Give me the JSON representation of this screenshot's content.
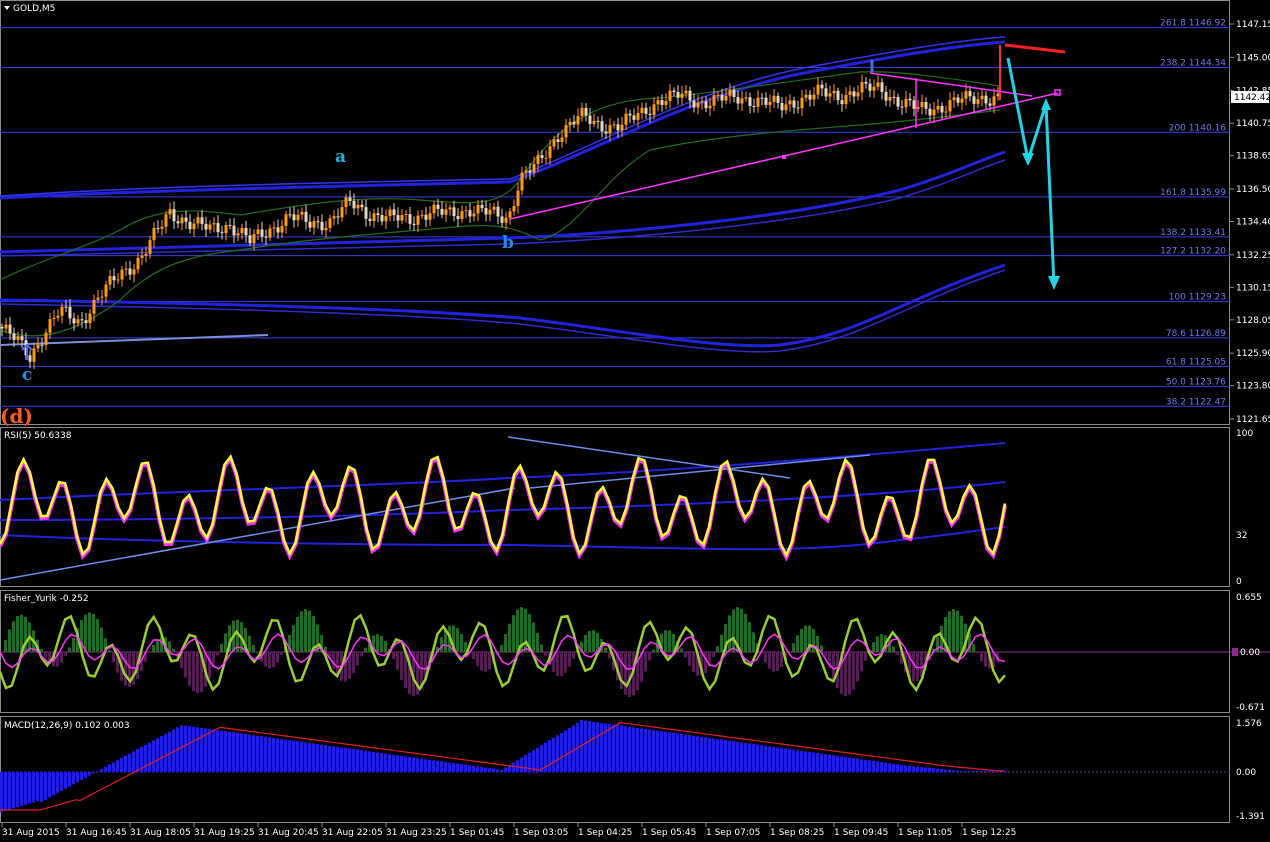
{
  "symbol_title": "GOLD,M5",
  "colors": {
    "background": "#000000",
    "fib_line": "#3a3fd8",
    "rsi_line": "#ffff33",
    "fisher_line": "#9acd32",
    "macd_hist": "#1f1fe0",
    "signal": "#e0205a",
    "trendline": "#ff33ff",
    "projection": "#22d3e6",
    "red_line": "#ff2020"
  },
  "main_axis": {
    "ticks": [
      "1147.15",
      "1145.00",
      "1142.85",
      "1140.75",
      "1138.65",
      "1136.50",
      "1134.40",
      "1132.25",
      "1130.15",
      "1128.05",
      "1125.90",
      "1123.80",
      "1121.65"
    ],
    "current_price": "1142.42"
  },
  "fib_levels": [
    {
      "label": "261.8 1146.92",
      "price": 1146.92
    },
    {
      "label": "238.2 1144.34",
      "price": 1144.34
    },
    {
      "label": "200 1140.16",
      "price": 1140.16
    },
    {
      "label": "161.8 1135.99",
      "price": 1135.99
    },
    {
      "label": "138.2 1133.41",
      "price": 1133.41
    },
    {
      "label": "127.2 1132.20",
      "price": 1132.2
    },
    {
      "label": "100 1129.23",
      "price": 1129.23
    },
    {
      "label": "78.6 1126.89",
      "price": 1126.89
    },
    {
      "label": "61.8 1125.05",
      "price": 1125.05
    },
    {
      "label": "50.0 1123.76",
      "price": 1123.76
    },
    {
      "label": "38.2 1122.47",
      "price": 1122.47
    }
  ],
  "wave_labels": {
    "a": "a",
    "b": "b",
    "c": "c",
    "d": "(d)"
  },
  "rsi": {
    "title": "RSI(5) 50.6338",
    "ticks": [
      "100",
      "32",
      "0"
    ]
  },
  "fisher": {
    "title": "Fisher_Yurik -0.252",
    "ticks": [
      "0.655",
      "0.00",
      "-0.671"
    ]
  },
  "macd": {
    "title": "MACD(12,26,9) 0.102 0.003",
    "ticks": [
      "1.576",
      "0.00",
      "-1.391"
    ]
  },
  "x_axis": [
    "31 Aug 2015",
    "31 Aug 16:45",
    "31 Aug 18:05",
    "31 Aug 19:25",
    "31 Aug 20:45",
    "31 Aug 22:05",
    "31 Aug 23:25",
    "1 Sep 01:45",
    "1 Sep 03:05",
    "1 Sep 04:25",
    "1 Sep 05:45",
    "1 Sep 07:05",
    "1 Sep 08:25",
    "1 Sep 09:45",
    "1 Sep 11:05",
    "1 Sep 12:25"
  ],
  "chart_data": {
    "type": "candlestick",
    "title": "GOLD,M5",
    "ylim": [
      1121.0,
      1148.0
    ],
    "price_path": [
      [
        0,
        1127.6
      ],
      [
        20,
        1126.5
      ],
      [
        30,
        1125.7
      ],
      [
        45,
        1127.3
      ],
      [
        60,
        1128.6
      ],
      [
        80,
        1127.9
      ],
      [
        100,
        1129.6
      ],
      [
        120,
        1131.0
      ],
      [
        140,
        1132.0
      ],
      [
        155,
        1133.5
      ],
      [
        170,
        1135.0
      ],
      [
        190,
        1134.3
      ],
      [
        210,
        1133.9
      ],
      [
        230,
        1134.2
      ],
      [
        250,
        1133.1
      ],
      [
        270,
        1133.9
      ],
      [
        290,
        1134.7
      ],
      [
        310,
        1134.3
      ],
      [
        330,
        1134.4
      ],
      [
        350,
        1135.6
      ],
      [
        370,
        1134.9
      ],
      [
        390,
        1134.6
      ],
      [
        410,
        1134.6
      ],
      [
        430,
        1135.0
      ],
      [
        450,
        1134.9
      ],
      [
        470,
        1135.2
      ],
      [
        490,
        1134.9
      ],
      [
        508,
        1134.6
      ],
      [
        520,
        1137.2
      ],
      [
        540,
        1138.2
      ],
      [
        560,
        1140.2
      ],
      [
        580,
        1141.2
      ],
      [
        600,
        1140.6
      ],
      [
        620,
        1140.6
      ],
      [
        640,
        1141.3
      ],
      [
        660,
        1142.3
      ],
      [
        680,
        1142.5
      ],
      [
        700,
        1142.1
      ],
      [
        720,
        1142.3
      ],
      [
        740,
        1142.4
      ],
      [
        760,
        1142.2
      ],
      [
        780,
        1141.8
      ],
      [
        800,
        1142.3
      ],
      [
        820,
        1142.7
      ],
      [
        840,
        1142.5
      ],
      [
        860,
        1142.9
      ],
      [
        880,
        1143.0
      ],
      [
        900,
        1142.1
      ],
      [
        920,
        1141.6
      ],
      [
        940,
        1141.8
      ],
      [
        960,
        1142.2
      ],
      [
        980,
        1142.4
      ],
      [
        1000,
        1142.4
      ]
    ],
    "fib_retracements": [
      1146.92,
      1144.34,
      1140.16,
      1135.99,
      1133.41,
      1132.2,
      1129.23,
      1126.89,
      1125.05,
      1123.76,
      1122.47
    ]
  }
}
